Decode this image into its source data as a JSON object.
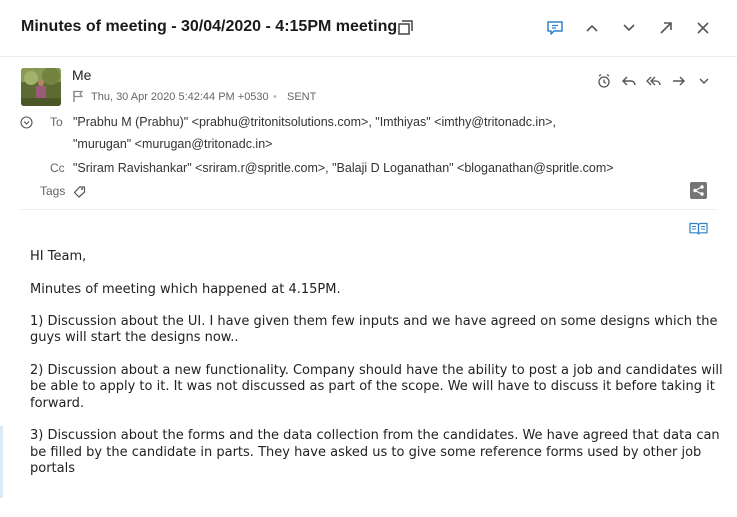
{
  "header": {
    "title": "Minutes of meeting - 30/04/2020 - 4:15PM meeting"
  },
  "message": {
    "sender": "Me",
    "date": "Thu, 30 Apr 2020 5:42:44 PM +0530",
    "separator": "•",
    "status": "SENT",
    "to_label": "To",
    "to_line1": "\"Prabhu M (Prabhu)\" <prabhu@tritonitsolutions.com>, \"Imthiyas\" <imthy@tritonadc.in>,",
    "to_line2": "\"murugan\" <murugan@tritonadc.in>",
    "cc_label": "Cc",
    "cc_line": "\"Sriram Ravishankar\" <sriram.r@spritle.com>, \"Balaji D Loganathan\" <bloganathan@spritle.com>",
    "tags_label": "Tags"
  },
  "body": {
    "greeting": "HI Team,",
    "intro": "Minutes of meeting which happened at 4.15PM.",
    "point1": "1) Discussion about the UI. I have given them few inputs and we have agreed on some designs which the guys will start the designs now..",
    "point2": "2) Discussion about a new functionality. Company should have the ability to post a job and candidates will be able to apply to it. It was not discussed as part of the scope. We will have to discuss it before taking it forward.",
    "point3": "3) Discussion about the forms and the  data collection from the candidates. We have agreed that data can be filled by the candidate in parts. They have asked us to give some reference forms used by other job portals"
  },
  "colors": {
    "accent": "#2f80c9",
    "icon": "#666666"
  }
}
